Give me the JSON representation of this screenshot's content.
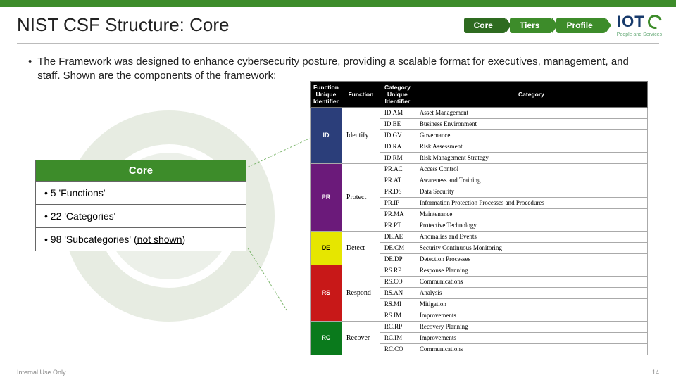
{
  "header": {
    "title": "NIST CSF Structure: Core",
    "nav": [
      "Core",
      "Tiers",
      "Profile"
    ],
    "logo_text": "IOT",
    "tagline": "People and Services"
  },
  "intro_bullet": "The Framework was designed to enhance cybersecurity posture, providing a scalable format for executives, management, and staff. Shown are the components of the framework:",
  "core_card": {
    "title": "Core",
    "items": [
      {
        "text": "5 'Functions'"
      },
      {
        "text": "22 'Categories'"
      },
      {
        "text_prefix": "98 'Subcategories' (",
        "underlined": "not shown",
        "text_suffix": ")"
      }
    ]
  },
  "fw_headers": [
    "Function Unique Identifier",
    "Function",
    "Category Unique Identifier",
    "Category"
  ],
  "functions": [
    {
      "id": "ID",
      "label": "Identify",
      "color": "c-id",
      "cats": [
        [
          "ID.AM",
          "Asset Management"
        ],
        [
          "ID.BE",
          "Business Environment"
        ],
        [
          "ID.GV",
          "Governance"
        ],
        [
          "ID.RA",
          "Risk Assessment"
        ],
        [
          "ID.RM",
          "Risk Management Strategy"
        ]
      ]
    },
    {
      "id": "PR",
      "label": "Protect",
      "color": "c-pr",
      "cats": [
        [
          "PR.AC",
          "Access Control"
        ],
        [
          "PR.AT",
          "Awareness and Training"
        ],
        [
          "PR.DS",
          "Data Security"
        ],
        [
          "PR.IP",
          "Information Protection Processes and Procedures"
        ],
        [
          "PR.MA",
          "Maintenance"
        ],
        [
          "PR.PT",
          "Protective Technology"
        ]
      ]
    },
    {
      "id": "DE",
      "label": "Detect",
      "color": "c-de",
      "cats": [
        [
          "DE.AE",
          "Anomalies and Events"
        ],
        [
          "DE.CM",
          "Security Continuous Monitoring"
        ],
        [
          "DE.DP",
          "Detection Processes"
        ]
      ]
    },
    {
      "id": "RS",
      "label": "Respond",
      "color": "c-rs",
      "cats": [
        [
          "RS.RP",
          "Response Planning"
        ],
        [
          "RS.CO",
          "Communications"
        ],
        [
          "RS.AN",
          "Analysis"
        ],
        [
          "RS.MI",
          "Mitigation"
        ],
        [
          "RS.IM",
          "Improvements"
        ]
      ]
    },
    {
      "id": "RC",
      "label": "Recover",
      "color": "c-rc",
      "cats": [
        [
          "RC.RP",
          "Recovery Planning"
        ],
        [
          "RC.IM",
          "Improvements"
        ],
        [
          "RC.CO",
          "Communications"
        ]
      ]
    }
  ],
  "footer": {
    "left": "Internal Use Only",
    "page": "14"
  }
}
